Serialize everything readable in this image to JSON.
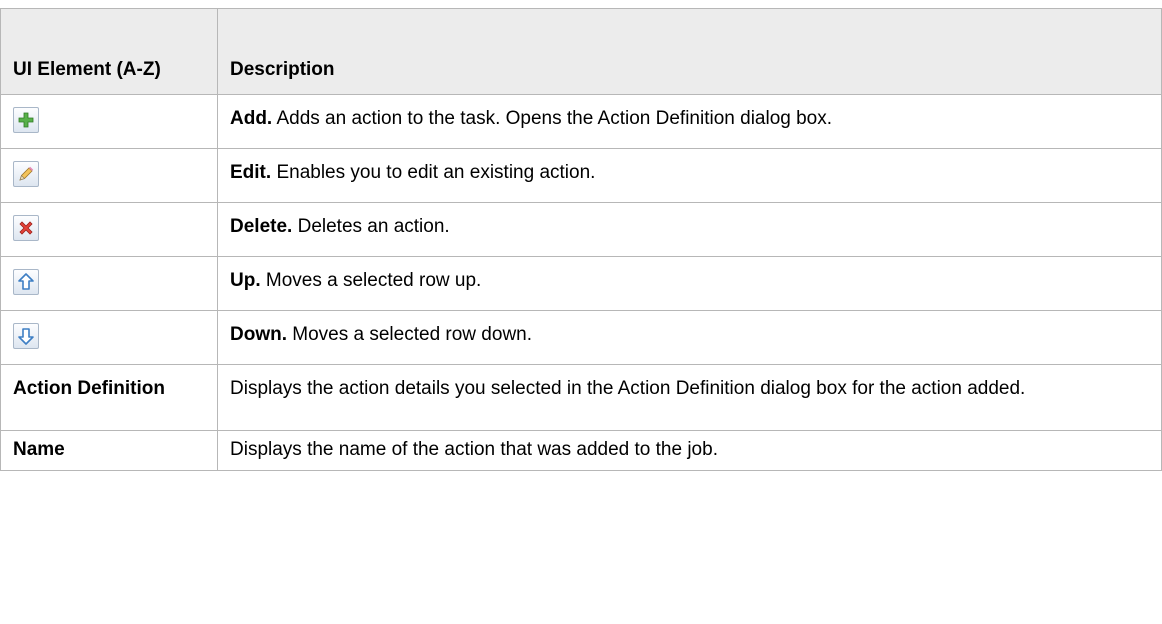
{
  "table": {
    "headers": {
      "ui_element": "UI Element (A-Z)",
      "description": "Description"
    },
    "rows": [
      {
        "icon": "add-icon",
        "label": "Add.",
        "text": " Adds an action to the task. Opens the Action Definition dialog box."
      },
      {
        "icon": "pencil-icon",
        "label": "Edit.",
        "text": " Enables you to edit an existing action."
      },
      {
        "icon": "delete-icon",
        "label": "Delete.",
        "text": " Deletes an action."
      },
      {
        "icon": "up-arrow-icon",
        "label": "Up.",
        "text": " Moves a selected row up."
      },
      {
        "icon": "down-arrow-icon",
        "label": "Down.",
        "text": " Moves a selected row down."
      },
      {
        "element": "Action Definition",
        "text": "Displays the action details you selected in the Action Definition dialog box for the action added."
      },
      {
        "element": "Name",
        "text": "Displays the name of the action that was added to the job."
      }
    ]
  }
}
